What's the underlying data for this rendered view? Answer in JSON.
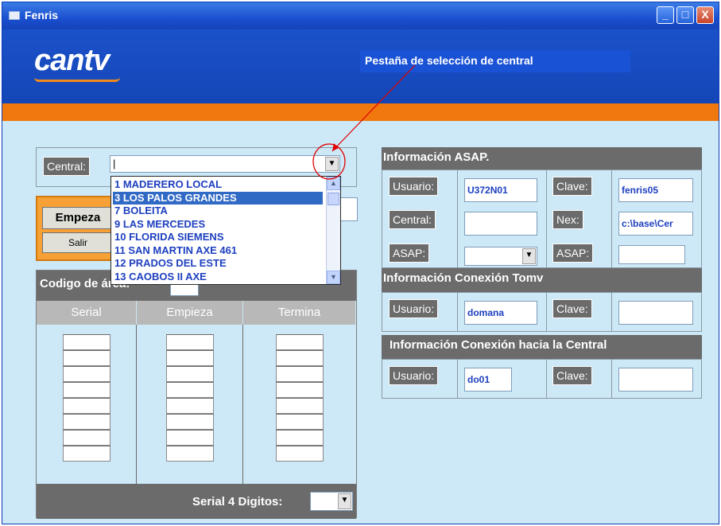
{
  "window": {
    "title": "Fenris",
    "icon": "app-icon",
    "controls": {
      "minimize": "_",
      "maximize": "□",
      "close": "X"
    }
  },
  "banner": {
    "logo_text": "cantv",
    "tab_label": "Pestaña de selección de central"
  },
  "central": {
    "label": "Central:",
    "value": "|",
    "dropdown_options": [
      "1 MADERERO LOCAL",
      "3 LOS PALOS GRANDES",
      "7 BOLEITA",
      "9 LAS MERCEDES",
      "10 FLORIDA SIEMENS",
      "11 SAN MARTIN AXE 461",
      "12 PRADOS DEL ESTE",
      "13 CAOBOS II AXE"
    ],
    "selected_index": 1
  },
  "buttons": {
    "empieza": "Empeza",
    "salir": "Salir"
  },
  "grid": {
    "codigo_label": "Codigo de área:",
    "columns": [
      "Serial",
      "Empieza",
      "Termina"
    ],
    "rows": 8,
    "serial4_label": "Serial 4 Digitos:"
  },
  "info_asap": {
    "header": "Información ASAP.",
    "usuario_label": "Usuario:",
    "usuario_value": "U372N01",
    "clave_label": "Clave:",
    "clave_value": "fenris05",
    "central_label": "Central:",
    "central_value": "",
    "nex_label": "Nex:",
    "nex_value": "c:\\base\\Cer",
    "asap_label_1": "ASAP:",
    "asap_label_2": "ASAP:"
  },
  "info_tomv": {
    "header": "Información Conexión Tomv",
    "usuario_label": "Usuario:",
    "usuario_value": "domana",
    "clave_label": "Clave:",
    "clave_value": ""
  },
  "info_central": {
    "header": "Información Conexión hacia la Central",
    "usuario_label": "Usuario:",
    "usuario_value": "do01",
    "clave_label": "Clave:",
    "clave_value": ""
  },
  "colors": {
    "title_bar": "#1a4fd0",
    "banner": "#1446b7",
    "orange": "#f0780e",
    "background": "#cde8f6",
    "label_gray": "#6b6b6b",
    "annotation": "#e00000"
  }
}
